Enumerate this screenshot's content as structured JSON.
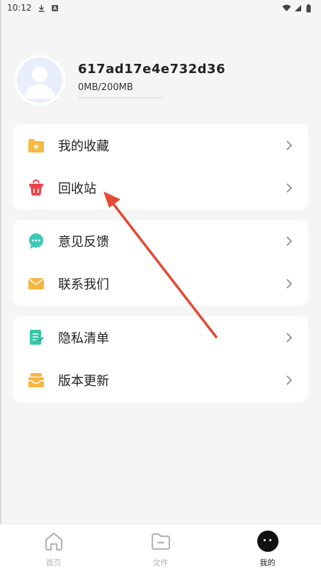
{
  "status_bar": {
    "time": "10:12"
  },
  "profile": {
    "username": "617ad17e4e732d36",
    "storage_text": "0MB/200MB",
    "storage_fraction": 0.0
  },
  "menu": {
    "group1": [
      {
        "label": "我的收藏",
        "icon": "folder-star-icon"
      },
      {
        "label": "回收站",
        "icon": "trash-bin-icon"
      }
    ],
    "group2": [
      {
        "label": "意见反馈",
        "icon": "chat-bubble-icon"
      },
      {
        "label": "联系我们",
        "icon": "envelope-icon"
      }
    ],
    "group3": [
      {
        "label": "隐私清单",
        "icon": "document-edit-icon"
      },
      {
        "label": "版本更新",
        "icon": "inbox-box-icon"
      }
    ]
  },
  "tabbar": {
    "home": "首页",
    "files": "文件",
    "mine": "我的"
  },
  "colors": {
    "accent": "#4a80f0",
    "arrow": "#e24a33",
    "folder": "#f9b942",
    "trash": "#e8444d",
    "chat": "#3ec9b6",
    "envelope": "#f8b640",
    "doc": "#37c9a8",
    "box": "#f8b640"
  }
}
